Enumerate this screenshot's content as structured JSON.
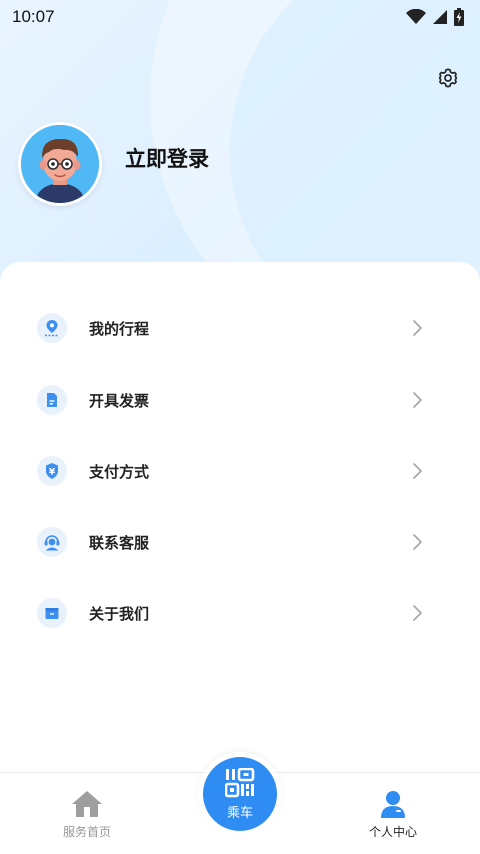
{
  "status_bar": {
    "time": "10:07"
  },
  "header": {
    "login_label": "立即登录"
  },
  "menu": {
    "items": [
      {
        "label": "我的行程",
        "icon": "location-pin-icon"
      },
      {
        "label": "开具发票",
        "icon": "invoice-icon"
      },
      {
        "label": "支付方式",
        "icon": "yuan-shield-icon"
      },
      {
        "label": "联系客服",
        "icon": "headset-agent-icon"
      },
      {
        "label": "关于我们",
        "icon": "box-icon"
      }
    ]
  },
  "tabbar": {
    "home_label": "服务首页",
    "ride_label": "乘车",
    "profile_label": "个人中心"
  },
  "colors": {
    "accent": "#2f8cf2",
    "icon_blue": "#3d8ff0",
    "inactive_gray": "#999999"
  }
}
